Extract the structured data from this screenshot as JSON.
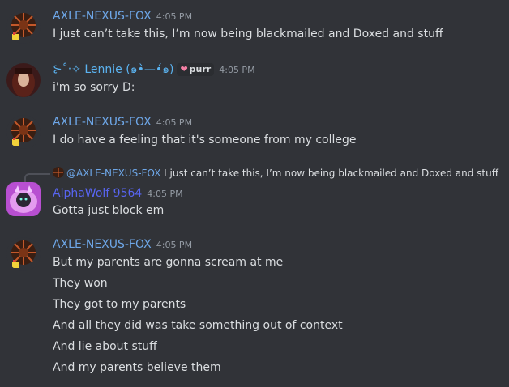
{
  "colors": {
    "background": "#313338",
    "axle_name": "#6ea7e8",
    "lennie_name": "#5bb3f0",
    "alpha_name": "#5865f2",
    "timestamp": "#949ba4",
    "text": "#dbdee1"
  },
  "messages": [
    {
      "author": "AXLE-NEXUS-FOX",
      "time": "4:05 PM",
      "avatar_icon": "fox-pixel-avatar",
      "lines": [
        "I just can’t take this, I’m now being blackmailed and Doxed and stuff"
      ]
    },
    {
      "author": "⊱˚‧✧ Lennie (๑•̀—•́๑)",
      "badge": "purr",
      "time": "4:05 PM",
      "avatar_icon": "lennie-avatar",
      "lines": [
        "i'm so sorry D:"
      ]
    },
    {
      "author": "AXLE-NEXUS-FOX",
      "time": "4:05 PM",
      "avatar_icon": "fox-pixel-avatar",
      "lines": [
        "I do have a feeling that it's someone from my college"
      ]
    },
    {
      "reply_to": {
        "author": "@AXLE-NEXUS-FOX",
        "text": "I just can’t take this, I’m now being blackmailed and Doxed and stuff"
      },
      "author": "AlphaWolf 9564",
      "time": "4:05 PM",
      "avatar_icon": "wolf-avatar",
      "lines": [
        "Gotta just block em"
      ]
    },
    {
      "author": "AXLE-NEXUS-FOX",
      "time": "4:05 PM",
      "avatar_icon": "fox-pixel-avatar",
      "lines": [
        "But my parents are gonna scream at me",
        "They won",
        "They got to my parents",
        "And all they did was take something out of context",
        "And lie about stuff",
        "And my parents believe them"
      ]
    }
  ]
}
